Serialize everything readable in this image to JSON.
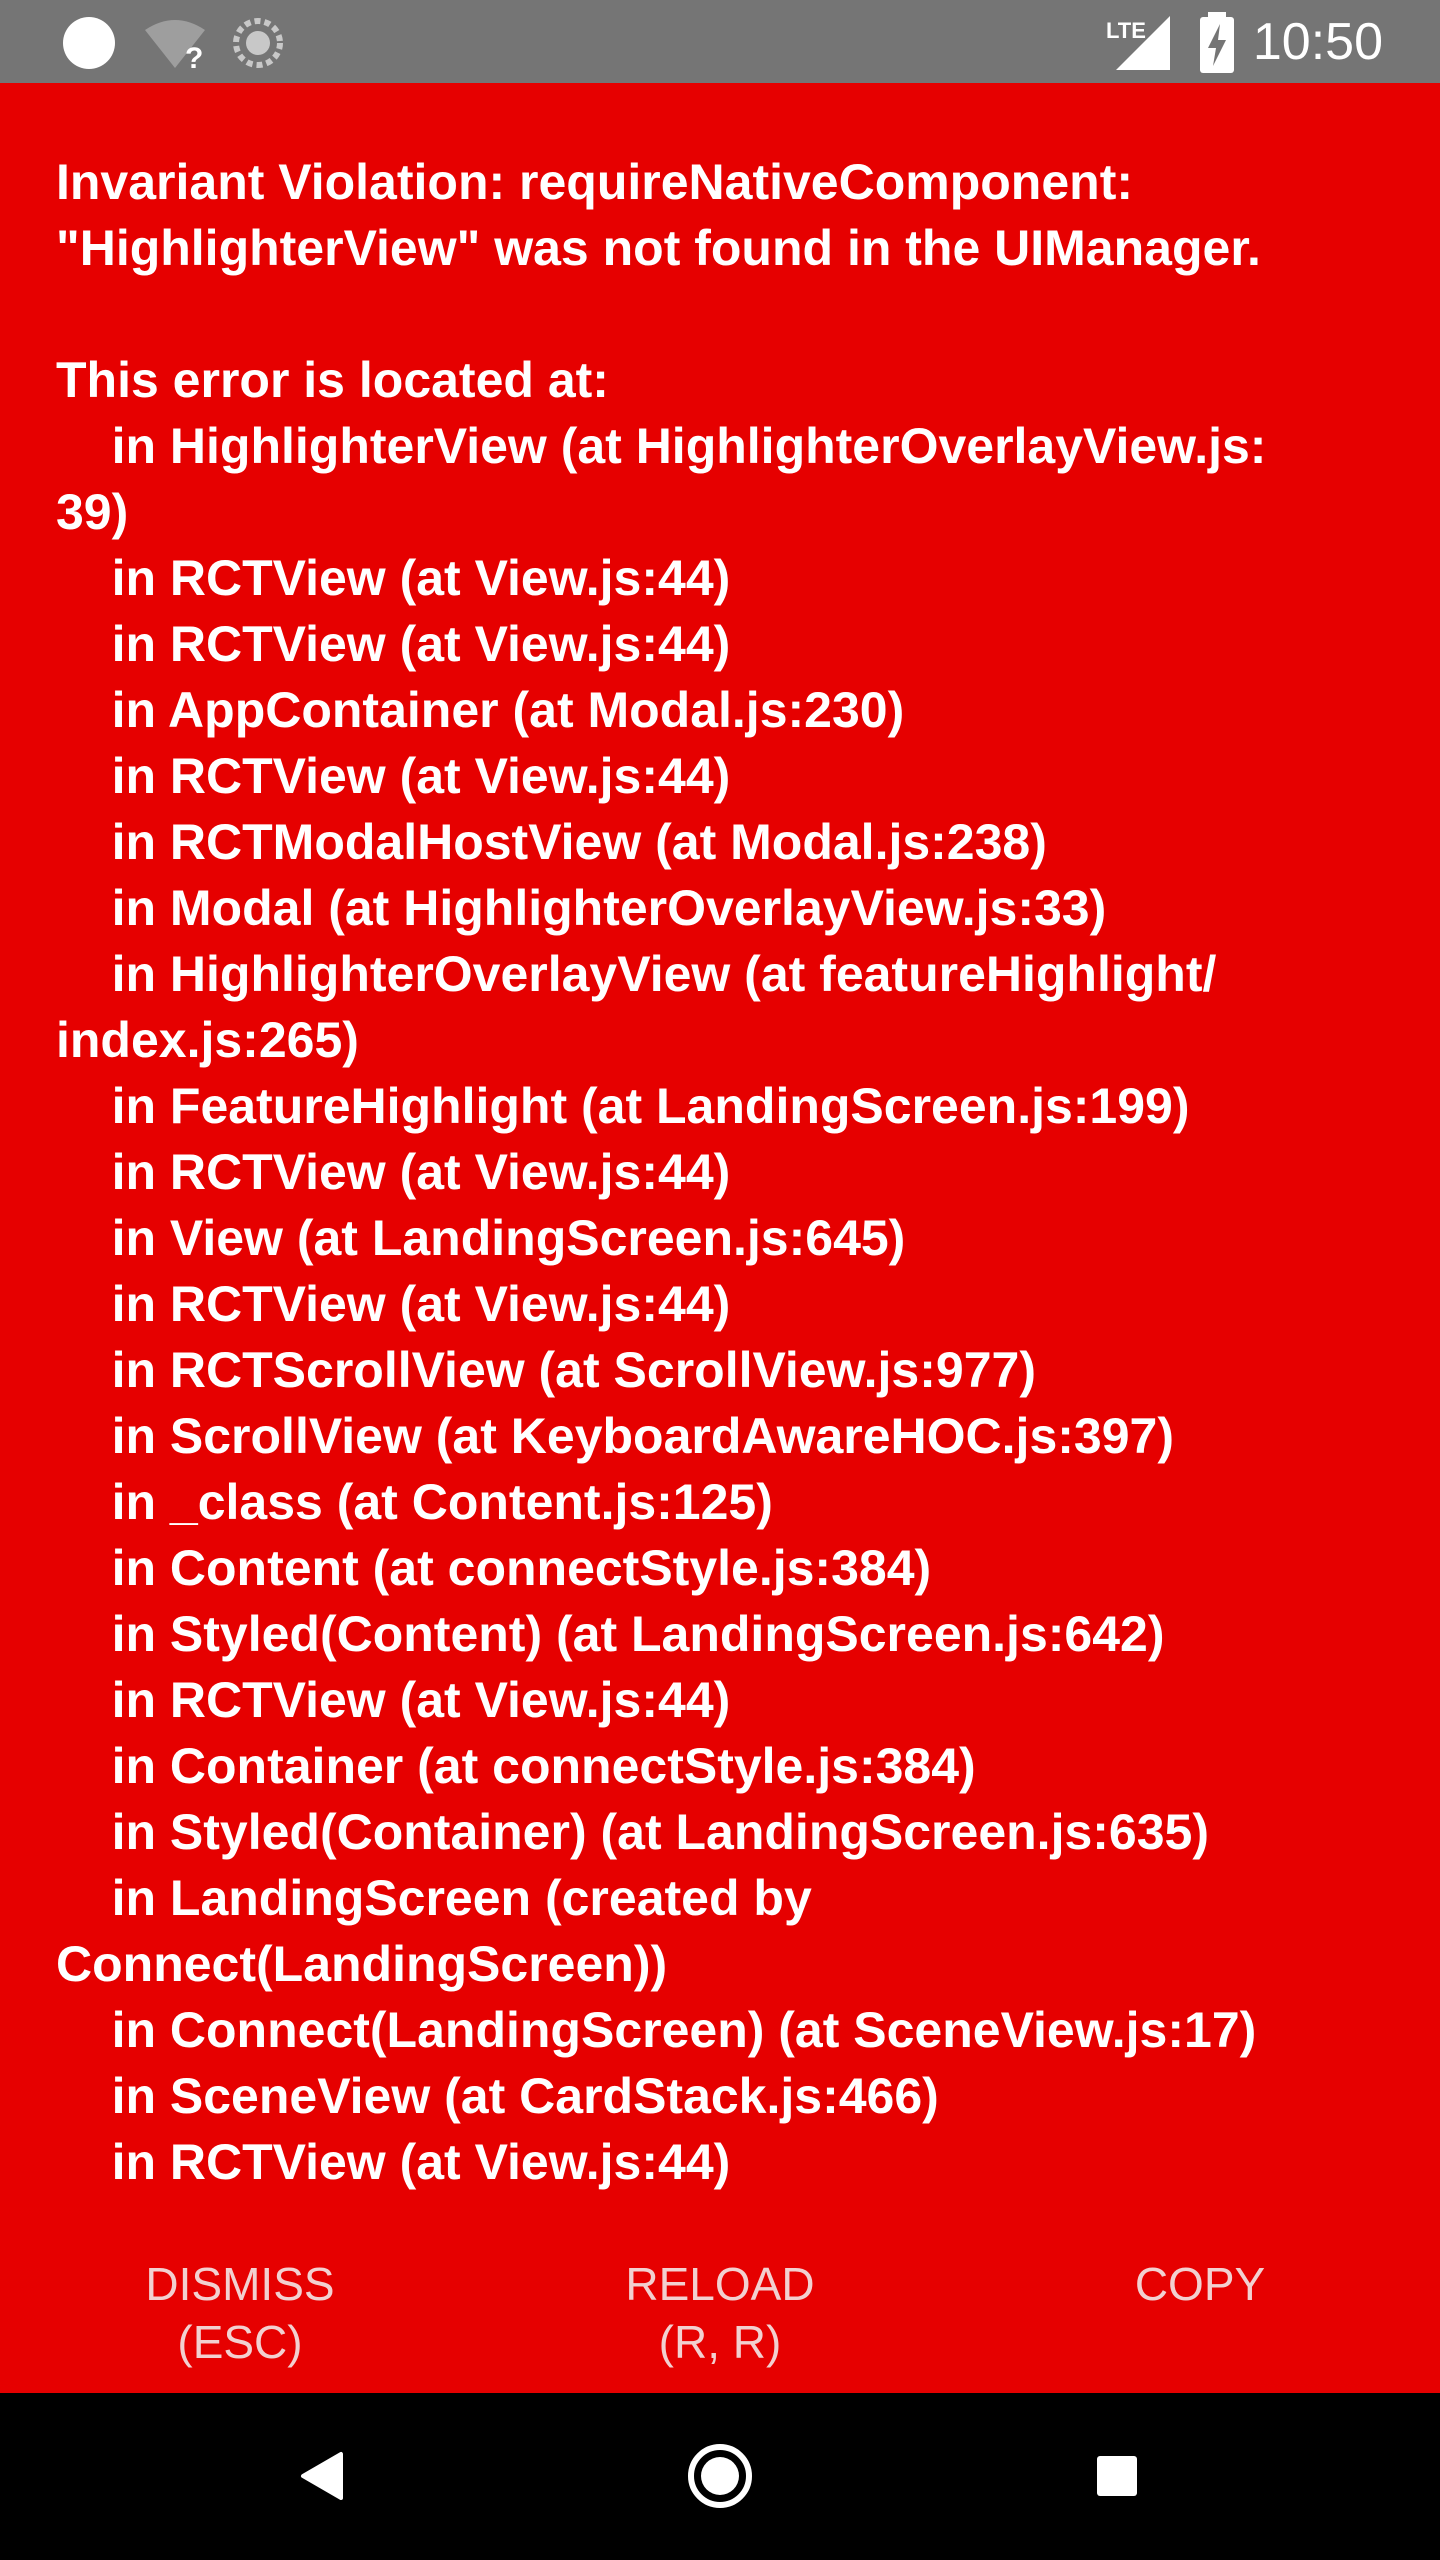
{
  "status_bar": {
    "time": "10:50",
    "network_label": "LTE",
    "icons": [
      "notification-dot-icon",
      "wifi-unknown-icon",
      "sync-icon",
      "lte-signal-icon",
      "battery-charging-icon"
    ]
  },
  "error": {
    "message": "Invariant Violation: requireNativeComponent:\n\"HighlighterView\" was not found in the UIManager.\n\nThis error is located at:\n    in HighlighterView (at HighlighterOverlayView.js:\n39)\n    in RCTView (at View.js:44)\n    in RCTView (at View.js:44)\n    in AppContainer (at Modal.js:230)\n    in RCTView (at View.js:44)\n    in RCTModalHostView (at Modal.js:238)\n    in Modal (at HighlighterOverlayView.js:33)\n    in HighlighterOverlayView (at featureHighlight/\nindex.js:265)\n    in FeatureHighlight (at LandingScreen.js:199)\n    in RCTView (at View.js:44)\n    in View (at LandingScreen.js:645)\n    in RCTView (at View.js:44)\n    in RCTScrollView (at ScrollView.js:977)\n    in ScrollView (at KeyboardAwareHOC.js:397)\n    in _class (at Content.js:125)\n    in Content (at connectStyle.js:384)\n    in Styled(Content) (at LandingScreen.js:642)\n    in RCTView (at View.js:44)\n    in Container (at connectStyle.js:384)\n    in Styled(Container) (at LandingScreen.js:635)\n    in LandingScreen (created by\nConnect(LandingScreen))\n    in Connect(LandingScreen) (at SceneView.js:17)\n    in SceneView (at CardStack.js:466)\n    in RCTView (at View.js:44)"
  },
  "actions": {
    "dismiss": {
      "label": "DISMISS",
      "shortcut": "(ESC)"
    },
    "reload": {
      "label": "RELOAD",
      "shortcut": "(R, R)"
    },
    "copy": {
      "label": "COPY"
    }
  },
  "nav_bar": {
    "icons": [
      "back-icon",
      "home-icon",
      "recents-icon"
    ]
  },
  "colors": {
    "error_background": "#e60000",
    "status_bar": "#757575",
    "nav_bar": "#000000",
    "text": "#ffffff",
    "action_text": "#f2d0d0"
  }
}
